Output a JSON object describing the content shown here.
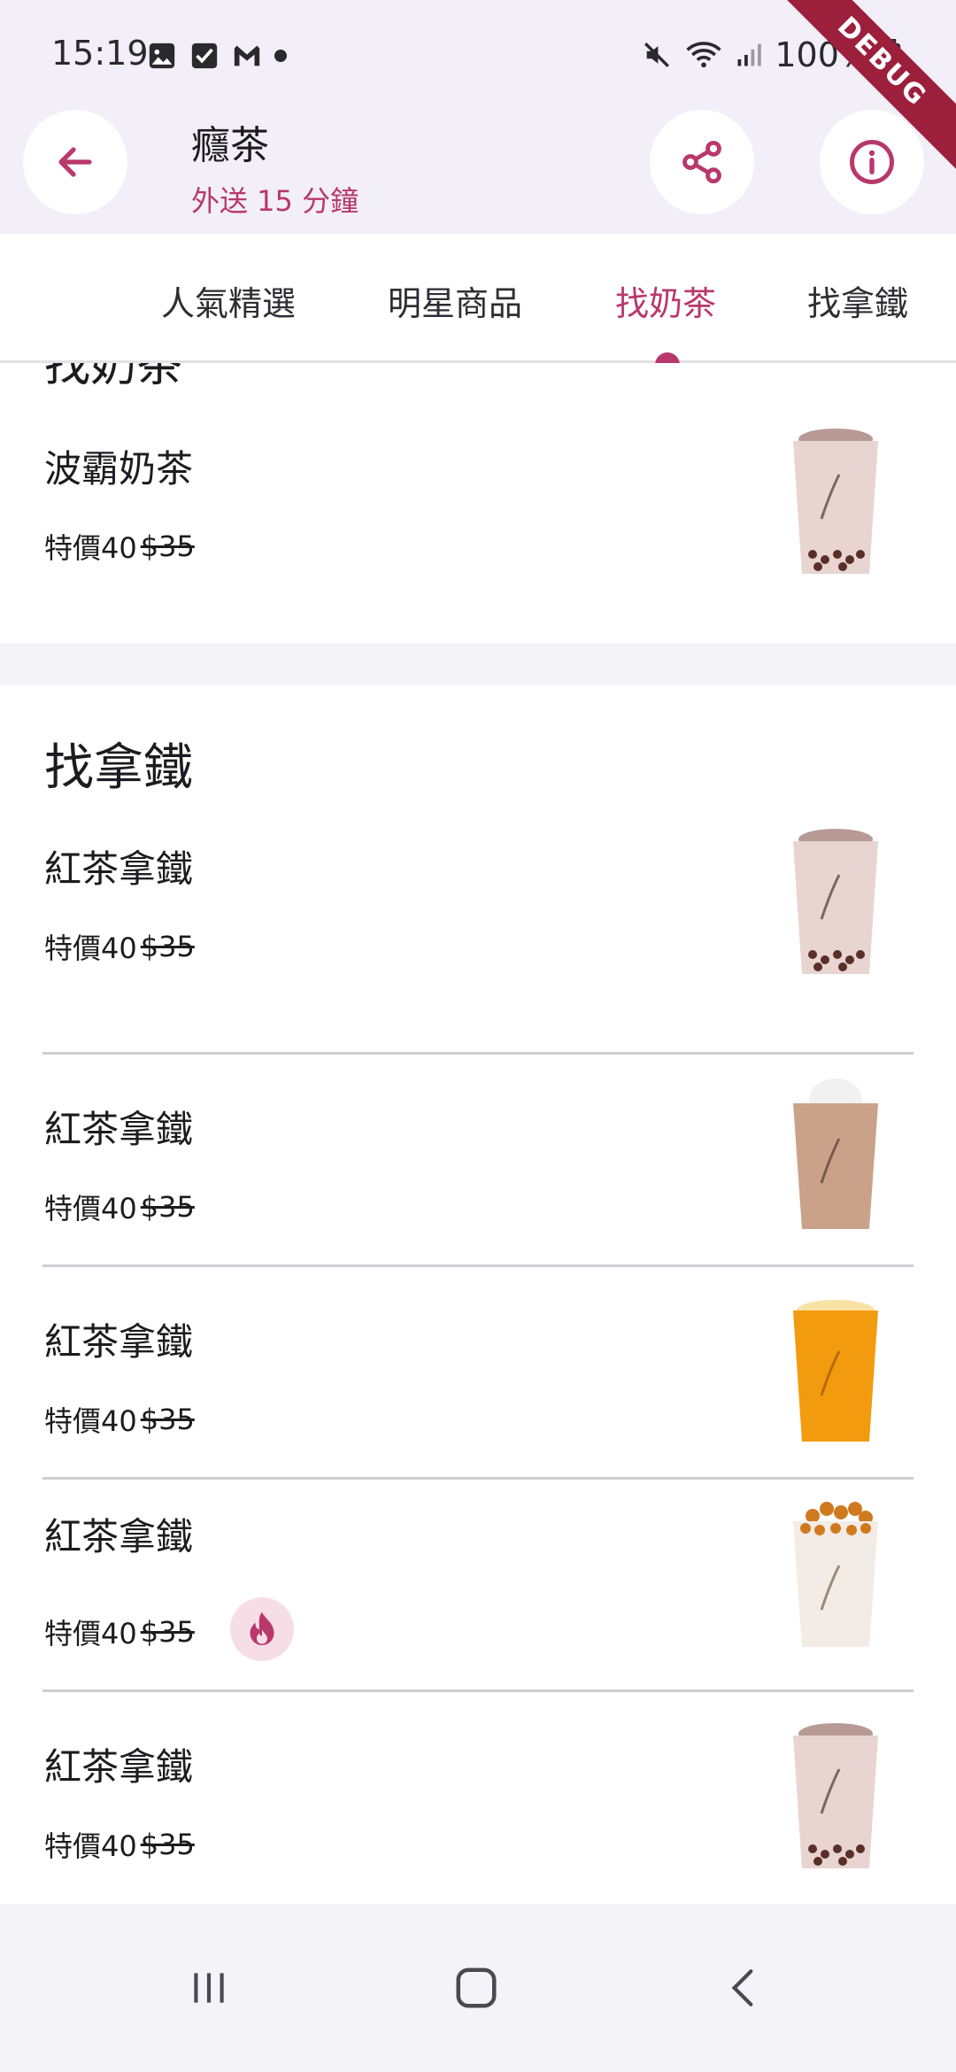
{
  "status_bar": {
    "time": "15:19",
    "battery": "100%",
    "left_icons": [
      "gallery-icon",
      "check-box-icon",
      "gmail-icon",
      "dot-icon"
    ],
    "right_icons": [
      "mute-icon",
      "wifi-icon",
      "signal-icon",
      "battery-icon"
    ]
  },
  "debug_banner": "DEBUG",
  "app_bar": {
    "title": "癮茶",
    "subtitle": "外送 15 分鐘",
    "accent_color": "#b8386c"
  },
  "tabs": [
    {
      "label": "人氣精選",
      "active": false
    },
    {
      "label": "明星商品",
      "active": false
    },
    {
      "label": "找奶茶",
      "active": true
    },
    {
      "label": "找拿鐵",
      "active": false
    }
  ],
  "sections": [
    {
      "title": "找奶茶",
      "items": [
        {
          "name": "波霸奶茶",
          "price_prefix": "特價40",
          "old_price": "$35",
          "image": "bubble-milk-tea",
          "hot": false
        }
      ]
    },
    {
      "title": "找拿鐵",
      "items": [
        {
          "name": "紅茶拿鐵",
          "price_prefix": "特價40",
          "old_price": "$35",
          "image": "bubble-milk-tea",
          "hot": false
        },
        {
          "name": "紅茶拿鐵",
          "price_prefix": "特價40",
          "old_price": "$35",
          "image": "cream-milk-tea",
          "hot": false
        },
        {
          "name": "紅茶拿鐵",
          "price_prefix": "特價40",
          "old_price": "$35",
          "image": "orange-tea",
          "hot": false
        },
        {
          "name": "紅茶拿鐵",
          "price_prefix": "特價40",
          "old_price": "$35",
          "image": "golden-bubble-latte",
          "hot": true
        },
        {
          "name": "紅茶拿鐵",
          "price_prefix": "特價40",
          "old_price": "$35",
          "image": "bubble-milk-tea",
          "hot": false
        }
      ]
    }
  ],
  "nav_bar": {
    "buttons": [
      "recent-apps-icon",
      "home-icon",
      "back-icon"
    ]
  }
}
